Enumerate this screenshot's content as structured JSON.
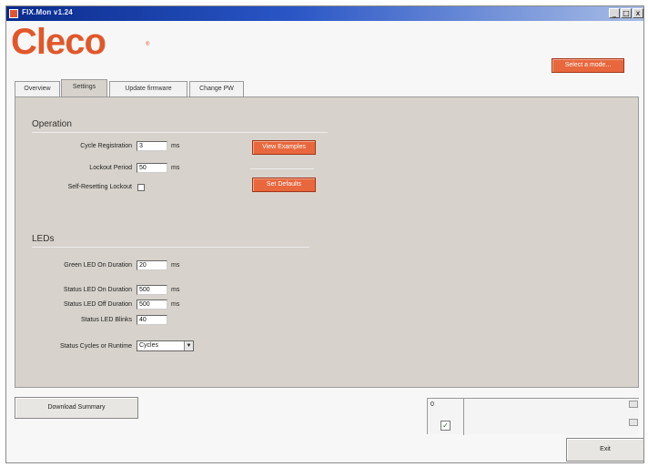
{
  "window": {
    "title": "FIX.Mon v1.24",
    "minimize_glyph": "_",
    "maximize_glyph": "□",
    "close_glyph": "x"
  },
  "brand": {
    "logo_text": "Cleco",
    "logo_mark": "®",
    "color": "#e2572a"
  },
  "header": {
    "select_mode_label": "Select a mode..."
  },
  "tabs": [
    {
      "label": "Overview",
      "active": false
    },
    {
      "label": "Settings",
      "active": true
    },
    {
      "label": "Update firmware",
      "active": false
    },
    {
      "label": "Change PW",
      "active": false
    }
  ],
  "operation": {
    "title": "Operation",
    "cycle_registration": {
      "label": "Cycle Registration",
      "value": "3",
      "unit": "ms"
    },
    "lockout_period": {
      "label": "Lockout Period",
      "value": "50",
      "unit": "ms"
    },
    "self_resetting_lockout": {
      "label": "Self-Resetting Lockout",
      "checked": false
    },
    "view_examples_label": "View Examples",
    "set_defaults_label": "Set Defaults"
  },
  "leds": {
    "title": "LEDs",
    "green_led_on": {
      "label": "Green LED On Duration",
      "value": "20",
      "unit": "ms"
    },
    "status_led_on": {
      "label": "Status LED On Duration",
      "value": "500",
      "unit": "ms"
    },
    "status_led_off": {
      "label": "Status LED Off Duration",
      "value": "500",
      "unit": "ms"
    },
    "status_led_blinks": {
      "label": "Status LED Blinks",
      "value": "40"
    },
    "status_mode": {
      "label": "Status Cycles or Runtime",
      "selected": "Cycles"
    }
  },
  "footer": {
    "download_summary_label": "Download Summary",
    "status_value": "0",
    "status_checked": true,
    "exit_label": "Exit"
  },
  "colors": {
    "accent": "#e8673d",
    "panel": "#d7d2cb",
    "titlebar": "#0a2b8c"
  }
}
